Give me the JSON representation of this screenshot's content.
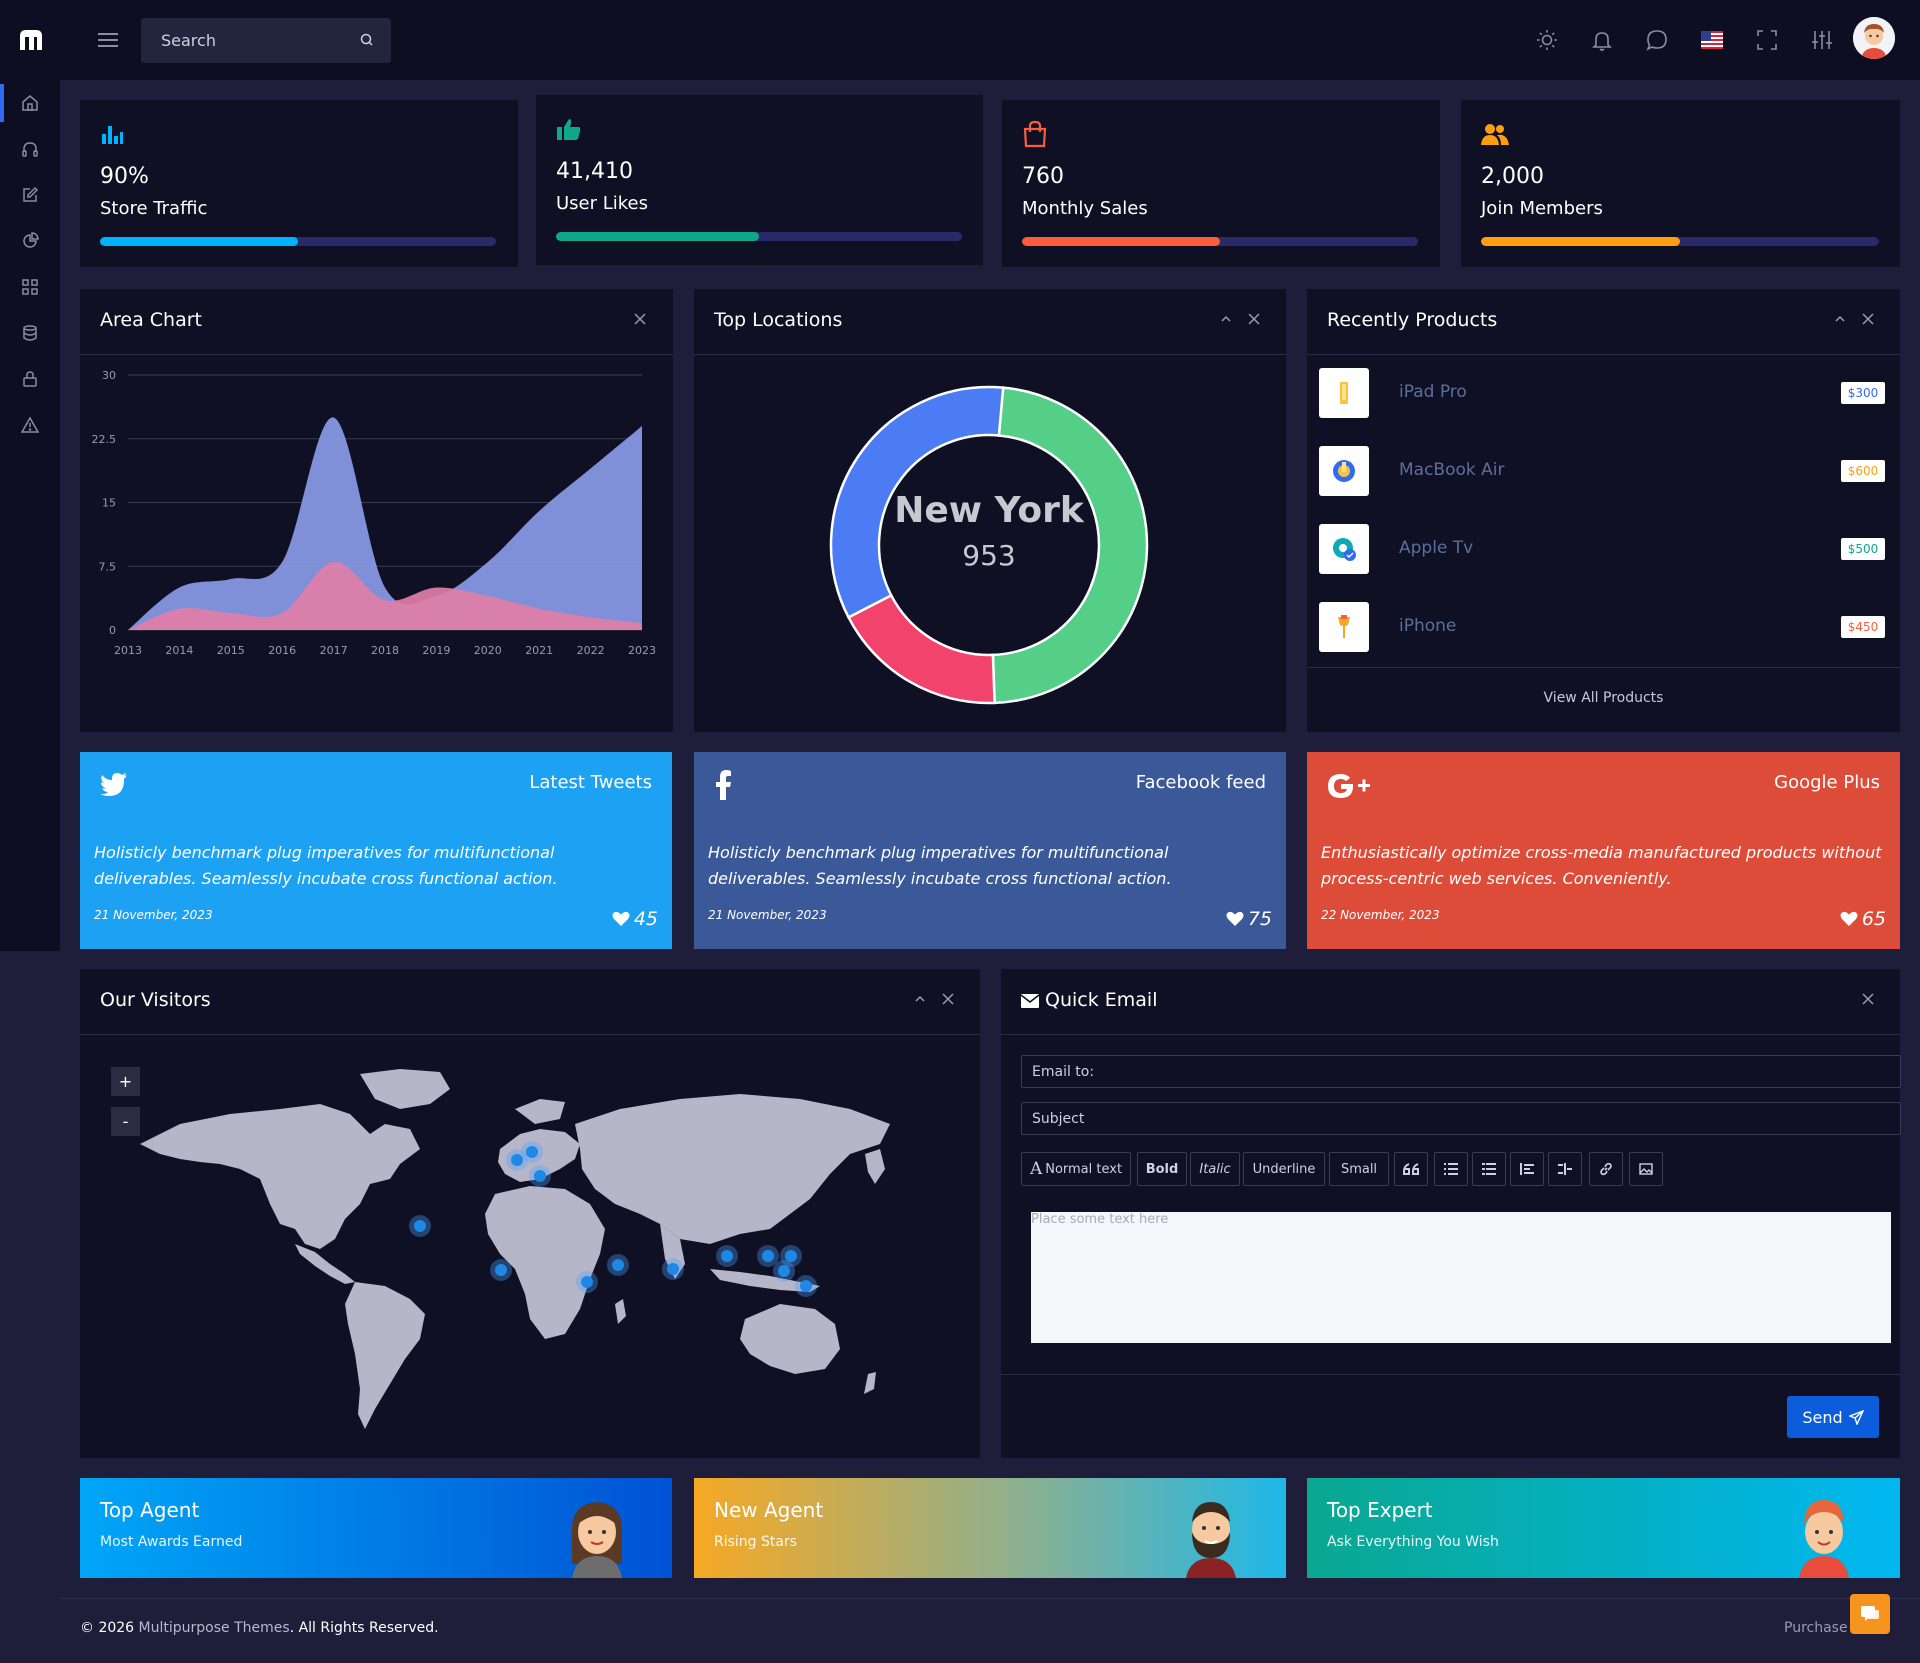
{
  "header": {
    "search_placeholder": "Search"
  },
  "stats": [
    {
      "value": "90%",
      "label": "Store Traffic",
      "progress": 0.5,
      "color": "#00b2ff",
      "icon": "bar-chart-icon"
    },
    {
      "value": "41,410",
      "label": "User Likes",
      "progress": 0.5,
      "color": "#0fa888",
      "icon": "thumbs-up-icon"
    },
    {
      "value": "760",
      "label": "Monthly Sales",
      "progress": 0.5,
      "color": "#fb5d3c",
      "icon": "shopping-bag-icon"
    },
    {
      "value": "2,000",
      "label": "Join Members",
      "progress": 0.5,
      "color": "#ff9f10",
      "icon": "users-icon"
    }
  ],
  "area_chart": {
    "title": "Area Chart",
    "chart_data": {
      "type": "area",
      "x": [
        "2013",
        "2014",
        "2015",
        "2016",
        "2017",
        "2018",
        "2019",
        "2020",
        "2021",
        "2022",
        "2023"
      ],
      "yticks": [
        "0",
        "7.5",
        "15",
        "22.5",
        "30"
      ],
      "ylim": [
        0,
        30
      ],
      "series": [
        {
          "values": [
            0,
            5,
            6,
            8,
            25,
            5,
            4,
            8,
            14,
            19,
            24
          ],
          "color": "#8a9be8"
        },
        {
          "values": [
            0,
            2.5,
            2,
            2,
            8,
            3.5,
            5,
            4,
            2.5,
            1.5,
            0.8
          ],
          "color": "#e17ea8"
        }
      ]
    }
  },
  "top_locations": {
    "title": "Top Locations",
    "center_label": "New York",
    "center_value": "953",
    "chart_data": {
      "type": "pie",
      "slices": [
        {
          "value": 48,
          "color": "#55ce87"
        },
        {
          "value": 18,
          "color": "#f2436c"
        },
        {
          "value": 34,
          "color": "#4c7cf3"
        }
      ]
    }
  },
  "products": {
    "title": "Recently Products",
    "items": [
      {
        "name": "iPad Pro",
        "price": "$300",
        "price_color": "#2f6cf2"
      },
      {
        "name": "MacBook Air",
        "price": "$600",
        "price_color": "#ff9f10"
      },
      {
        "name": "Apple Tv",
        "price": "$500",
        "price_color": "#0fa888"
      },
      {
        "name": "iPhone",
        "price": "$450",
        "price_color": "#fb5d3c"
      }
    ],
    "view_all": "View All Products"
  },
  "social": [
    {
      "title": "Latest Tweets",
      "text": "Holisticly benchmark plug imperatives for multifunctional deliverables. Seamlessly incubate cross functional action.",
      "date": "21 November, 2023",
      "likes": "45",
      "color": "#1da1f2",
      "icon": "twitter-icon"
    },
    {
      "title": "Facebook feed",
      "text": "Holisticly benchmark plug imperatives for multifunctional deliverables. Seamlessly incubate cross functional action.",
      "date": "21 November, 2023",
      "likes": "75",
      "color": "#3b5998",
      "icon": "facebook-icon"
    },
    {
      "title": "Google Plus",
      "text": "Enthusiastically optimize cross-media manufactured products without process-centric web services. Conveniently.",
      "date": "22 November, 2023",
      "likes": "65",
      "color": "#dd4b39",
      "icon": "google-plus-icon"
    }
  ],
  "visitors": {
    "title": "Our Visitors",
    "zoom_in": "+",
    "zoom_out": "-"
  },
  "email": {
    "title": "Quick Email",
    "to_placeholder": "Email to:",
    "subject_placeholder": "Subject",
    "toolbar": {
      "normal": "Normal text",
      "bold": "Bold",
      "italic": "Italic",
      "underline": "Underline",
      "small": "Small"
    },
    "body_placeholder": "Place some text here",
    "send": "Send"
  },
  "agents": [
    {
      "title": "Top Agent",
      "subtitle": "Most Awards Earned"
    },
    {
      "title": "New Agent",
      "subtitle": "Rising Stars"
    },
    {
      "title": "Top Expert",
      "subtitle": "Ask Everything You Wish"
    }
  ],
  "footer": {
    "copyright_prefix": "© 2026",
    "brand": "Multipurpose Themes",
    "copyright_suffix": ". All Rights Reserved.",
    "purchase": "Purchase Now"
  }
}
